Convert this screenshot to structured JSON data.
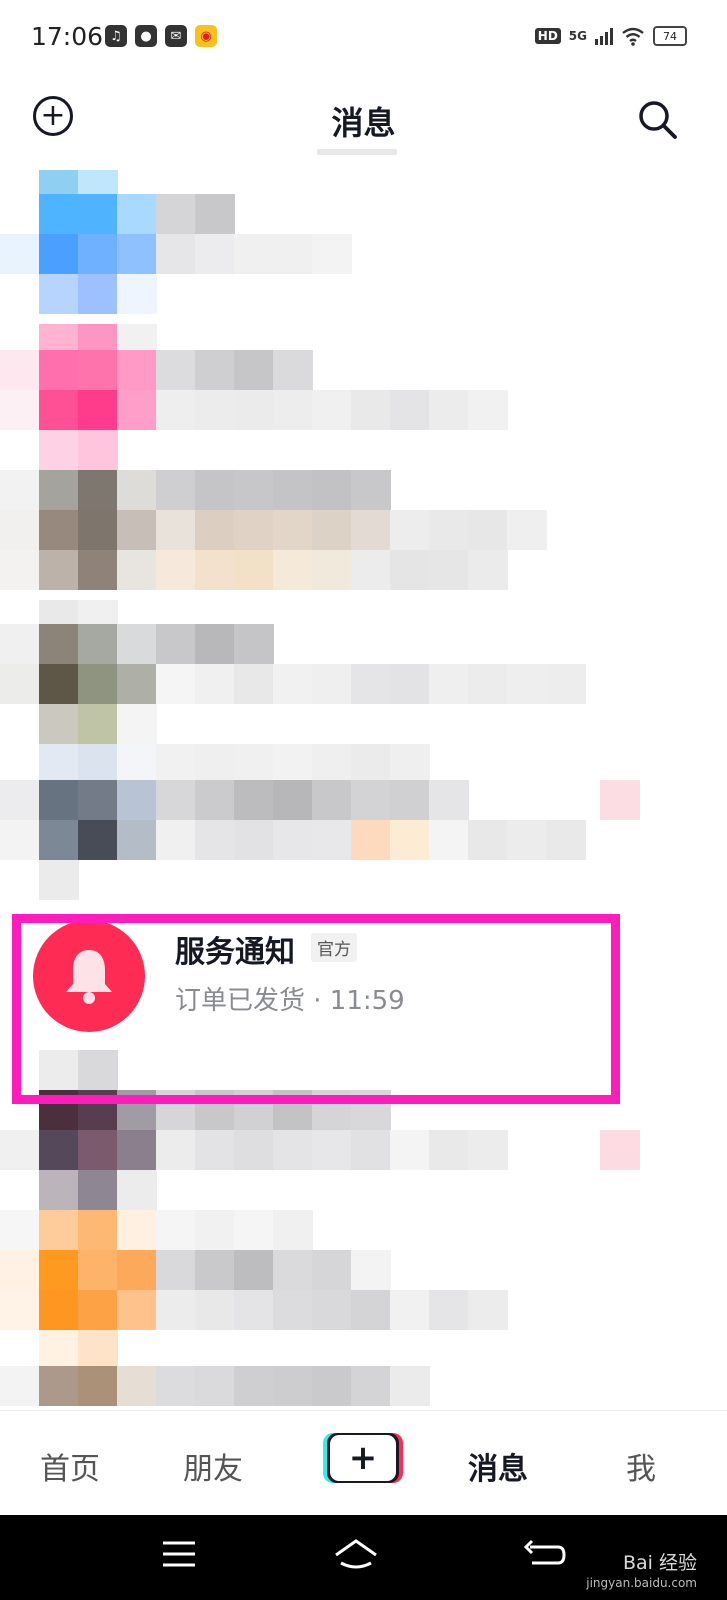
{
  "status_bar": {
    "time": "17:06",
    "network": "5G",
    "hd_label": "HD",
    "battery": "74",
    "left_icons": [
      "music-app-icon",
      "chat-app-icon",
      "mail-app-icon",
      "weibo-app-icon"
    ]
  },
  "header": {
    "title": "消息",
    "left_icon": "add-circle-icon",
    "right_icon": "search-icon"
  },
  "service_notification": {
    "name": "服务通知",
    "badge": "官方",
    "subtitle": "订单已发货 · 11:59",
    "avatar_icon": "bell-icon",
    "avatar_color": "#fe2c55"
  },
  "highlight_color": "#ff1cbd",
  "bottom_nav": {
    "items": [
      {
        "label": "首页"
      },
      {
        "label": "朋友"
      },
      {
        "label": "+"
      },
      {
        "label": "消息"
      },
      {
        "label": "我"
      }
    ],
    "active": "消息"
  },
  "system_nav": {
    "icons": [
      "menu-icon",
      "home-icon",
      "back-icon"
    ]
  },
  "watermark": {
    "text": "Bai 经验",
    "url": "jingyan.baidu.com"
  }
}
